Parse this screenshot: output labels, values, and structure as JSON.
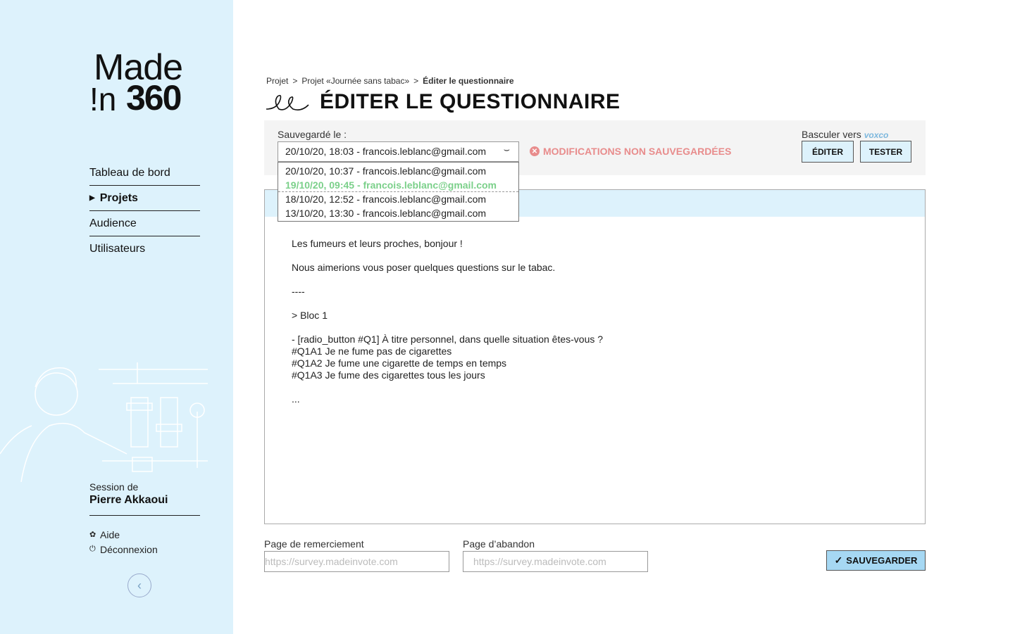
{
  "logo": {
    "made": "Made",
    "in": "!n",
    "number": "360"
  },
  "sidebar": {
    "items": [
      {
        "label": "Tableau de bord"
      },
      {
        "label": "Projets",
        "active": true
      },
      {
        "label": "Audience"
      },
      {
        "label": "Utilisateurs"
      }
    ],
    "session_label": "Session de",
    "session_name": "Pierre Akkaoui",
    "help": "Aide",
    "logout": "Déconnexion",
    "collapse_icon": "chevron-left-icon"
  },
  "breadcrumb": {
    "items": [
      "Projet",
      "Projet «Journée sans tabac»",
      "Éditer le questionnaire"
    ],
    "separator": ">"
  },
  "page_title": "ÉDITER LE QUESTIONNAIRE",
  "toolbar": {
    "saved_label": "Sauvegardé le :",
    "selected_version": "20/10/20, 18:03 - francois.leblanc@gmail.com",
    "warning": "MODIFICATIONS NON SAUVEGARDÉES",
    "switch_label": "Basculer vers",
    "switch_brand": "voxco",
    "edit_button": "ÉDITER",
    "test_button": "TESTER"
  },
  "dropdown": {
    "options": [
      "20/10/20, 10:37 - francois.leblanc@gmail.com",
      "19/10/20, 09:45 - francois.leblanc@gmail.com",
      "18/10/20, 12:52 - francois.leblanc@gmail.com",
      "13/10/20, 13:30 - francois.leblanc@gmail.com"
    ],
    "highlighted_index": 1
  },
  "editor": {
    "lines": [
      "Les fumeurs et leurs proches, bonjour !",
      "",
      "Nous aimerions vous poser quelques questions sur le tabac.",
      "",
      "----",
      "",
      "> Bloc 1",
      "",
      "- [radio_button #Q1] À titre personnel, dans quelle situation êtes-vous ?",
      "#Q1A1 Je ne fume pas de cigarettes",
      "#Q1A2 Je fume une cigarette de temps en temps",
      "#Q1A3 Je fume des cigarettes tous les jours",
      "",
      "..."
    ]
  },
  "footer": {
    "thanks_label": "Page de remerciement",
    "thanks_placeholder": "https://survey.madeinvote.com",
    "abandon_label": "Page d’abandon",
    "abandon_placeholder": "https://survey.madeinvote.com",
    "save_button": "SAUVEGARDER"
  },
  "colors": {
    "sidebar_bg": "#ddf2fc",
    "warning": "#e88c8c",
    "highlight": "#7bd08a",
    "save_bg": "#a6d8f3"
  }
}
